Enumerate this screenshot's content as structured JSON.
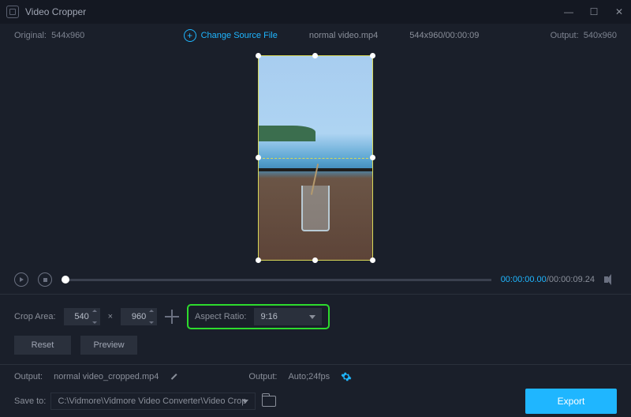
{
  "app": {
    "title": "Video Cropper"
  },
  "win": {
    "min": "—",
    "max": "☐",
    "close": "✕"
  },
  "info": {
    "original_label": "Original:",
    "original_dim": "544x960",
    "change_source": "Change Source File",
    "filename": "normal video.mp4",
    "source_dim_time": "544x960/00:00:09",
    "output_label": "Output:",
    "output_dim": "540x960"
  },
  "timeline": {
    "current": "00:00:00.00",
    "sep": "/",
    "total": "00:00:09.24"
  },
  "crop": {
    "area_label": "Crop Area:",
    "width": "540",
    "times": "×",
    "height": "960",
    "aspect_label": "Aspect Ratio:",
    "aspect_value": "9:16"
  },
  "buttons": {
    "reset": "Reset",
    "preview": "Preview",
    "export": "Export"
  },
  "output": {
    "label1": "Output:",
    "filename": "normal video_cropped.mp4",
    "label2": "Output:",
    "settings": "Auto;24fps"
  },
  "save": {
    "label": "Save to:",
    "path": "C:\\Vidmore\\Vidmore Video Converter\\Video Crop"
  }
}
